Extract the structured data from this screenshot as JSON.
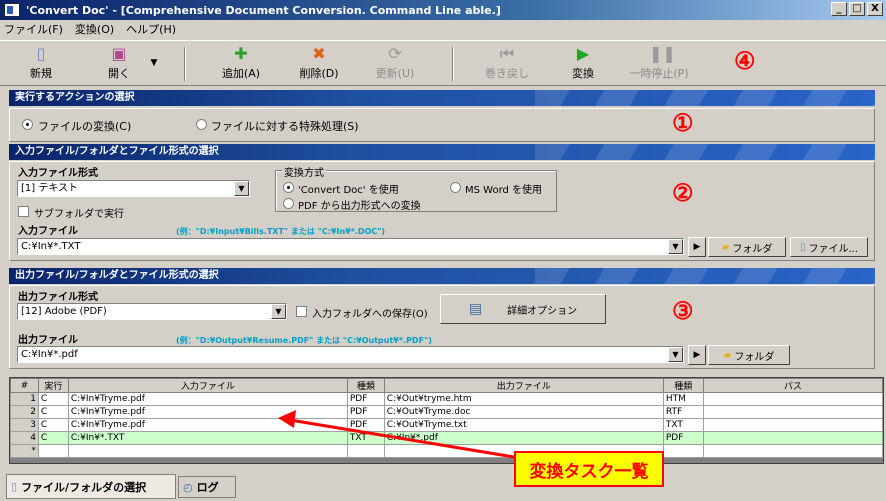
{
  "window": {
    "title": "'Convert Doc' - [Comprehensive Document Conversion. Command Line able.]",
    "controls": [
      "_",
      "□",
      "X"
    ]
  },
  "menu": [
    "ファイル(F)",
    "変換(O)",
    "ヘルプ(H)"
  ],
  "toolbar": {
    "new": "新規",
    "open": "開く",
    "add": "追加(A)",
    "delete": "削除(D)",
    "update": "更新(U)",
    "rewind": "巻き戻し",
    "convert": "変換",
    "pause": "一時停止(P)"
  },
  "markers": [
    "①",
    "②",
    "③",
    "④"
  ],
  "action_section": {
    "header": "実行するアクションの選択",
    "option_convert": "ファイルの変換(C)",
    "option_special": "ファイルに対する特殊処理(S)",
    "selected": "option_convert"
  },
  "input_section": {
    "header": "入力ファイル/フォルダとファイル形式の選択",
    "format_label": "入力ファイル形式",
    "format_value": "[1] テキスト",
    "subfolder_label": "サブフォルダで実行",
    "method_legend": "変換方式",
    "method_convertdoc": "'Convert Doc' を使用",
    "method_msword": "MS Word を使用",
    "method_pdf": "PDF から出力形式への変換",
    "file_label": "入力ファイル",
    "file_hint": "(例：\"D:¥Input¥Bills.TXT\" または \"C:¥In¥*.DOC\")",
    "file_value": "C:¥In¥*.TXT",
    "folder_button": "フォルダ",
    "file_button": "ファイル..."
  },
  "output_section": {
    "header": "出力ファイル/フォルダとファイル形式の選択",
    "format_label": "出力ファイル形式",
    "format_value": "[12] Adobe (PDF)",
    "save_in_input_label": "入力フォルダへの保存(O)",
    "advanced_button": "詳細オプション",
    "file_label": "出力ファイル",
    "file_hint": "(例：\"D:¥Output¥Resume.PDF\" または \"C:¥Output¥*.PDF\")",
    "file_value": "C:¥In¥*.pdf",
    "folder_button": "フォルダ"
  },
  "grid": {
    "headers": [
      "#",
      "実行",
      "入力ファイル",
      "種類",
      "出力ファイル",
      "種類",
      "パス"
    ],
    "rows": [
      [
        "1",
        "C",
        "C:¥In¥Tryme.pdf",
        "PDF",
        "C:¥Out¥tryme.htm",
        "HTM",
        ""
      ],
      [
        "2",
        "C",
        "C:¥In¥Tryme.pdf",
        "PDF",
        "C:¥Out¥Tryme.doc",
        "RTF",
        ""
      ],
      [
        "3",
        "C",
        "C:¥In¥Tryme.pdf",
        "PDF",
        "C:¥Out¥Tryme.txt",
        "TXT",
        ""
      ],
      [
        "4",
        "C",
        "C:¥In¥*.TXT",
        "TXT",
        "C:¥In¥*.pdf",
        "PDF",
        ""
      ],
      [
        "*",
        "",
        "",
        "",
        "",
        "",
        ""
      ]
    ],
    "selected_row": 3
  },
  "tabs": [
    "ファイル/フォルダの選択",
    "ログ"
  ],
  "callout": "変換タスク一覧",
  "colors": {
    "annotation": "#ff0000",
    "callout_bg": "#ffff00",
    "selected_row": "#ccffcc",
    "header_bar": "#0a246a"
  }
}
